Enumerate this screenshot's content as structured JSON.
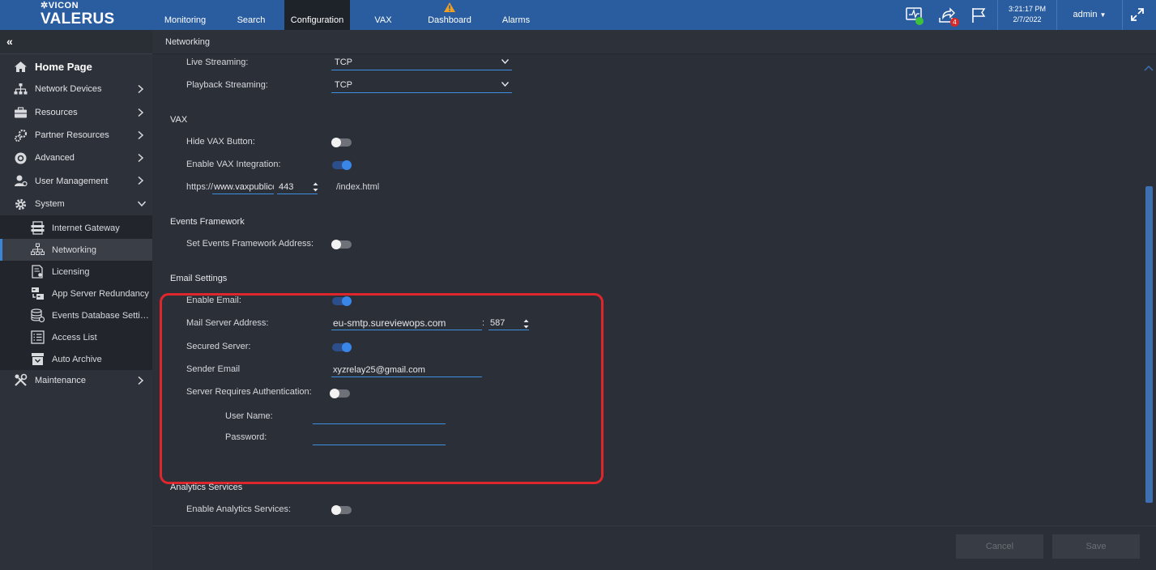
{
  "header": {
    "brand_top": "VICON",
    "brand_main": "VALERUS",
    "tabs": [
      {
        "label": "Monitoring"
      },
      {
        "label": "Search"
      },
      {
        "label": "Configuration"
      },
      {
        "label": "VAX"
      },
      {
        "label": "Dashboard"
      },
      {
        "label": "Alarms"
      }
    ],
    "share_badge": "4",
    "time": "3:21:17 PM",
    "date": "2/7/2022",
    "user": "admin",
    "colors": {
      "bar": "#2a5da0",
      "accent": "#3a86e8",
      "alert": "#e0262d"
    }
  },
  "sidebar": {
    "collapse_glyph": "«",
    "items": [
      {
        "label": "Home Page",
        "icon": "home-icon"
      },
      {
        "label": "Network Devices",
        "icon": "network-icon"
      },
      {
        "label": "Resources",
        "icon": "briefcase-icon"
      },
      {
        "label": "Partner Resources",
        "icon": "gears-icon"
      },
      {
        "label": "Advanced",
        "icon": "advanced-icon"
      },
      {
        "label": "User Management",
        "icon": "user-icon"
      },
      {
        "label": "System",
        "icon": "gear-icon"
      }
    ],
    "system_sub": [
      {
        "label": "Internet Gateway",
        "icon": "gateway-icon"
      },
      {
        "label": "Networking",
        "icon": "network-icon"
      },
      {
        "label": "Licensing",
        "icon": "license-icon"
      },
      {
        "label": "App Server Redundancy",
        "icon": "server-icon"
      },
      {
        "label": "Events Database Setti…",
        "icon": "database-icon"
      },
      {
        "label": "Access List",
        "icon": "list-icon"
      },
      {
        "label": "Auto Archive",
        "icon": "archive-icon"
      }
    ],
    "maintenance": {
      "label": "Maintenance",
      "icon": "tools-icon"
    }
  },
  "breadcrumb": "Networking",
  "streaming": {
    "live_label": "Live Streaming:",
    "live_value": "TCP",
    "playback_label": "Playback Streaming:",
    "playback_value": "TCP"
  },
  "vax": {
    "title": "VAX",
    "hide_button_label": "Hide VAX Button:",
    "hide_button_on": false,
    "enable_label": "Enable VAX Integration:",
    "enable_on": true,
    "url_prefix": "https://",
    "url_host": "www.vaxpubliccl",
    "url_port": "443",
    "url_suffix": "/index.html"
  },
  "events": {
    "title": "Events Framework",
    "set_address_label": "Set Events Framework Address:",
    "set_address_on": false
  },
  "email": {
    "title": "Email Settings",
    "enable_label": "Enable Email:",
    "enable_on": true,
    "server_label": "Mail Server Address:",
    "server_value": "eu-smtp.sureviewops.com",
    "port_sep": ":",
    "port_value": "587",
    "secured_label": "Secured Server:",
    "secured_on": true,
    "sender_label": "Sender Email",
    "sender_value": "xyzrelay25@gmail.com",
    "auth_label": "Server Requires Authentication:",
    "auth_on": false,
    "username_label": "User Name:",
    "username_value": "",
    "password_label": "Password:",
    "password_value": ""
  },
  "analytics": {
    "title": "Analytics Services",
    "enable_label": "Enable Analytics Services:",
    "enable_on": false
  },
  "footer": {
    "cancel_label": "Cancel",
    "save_label": "Save"
  }
}
